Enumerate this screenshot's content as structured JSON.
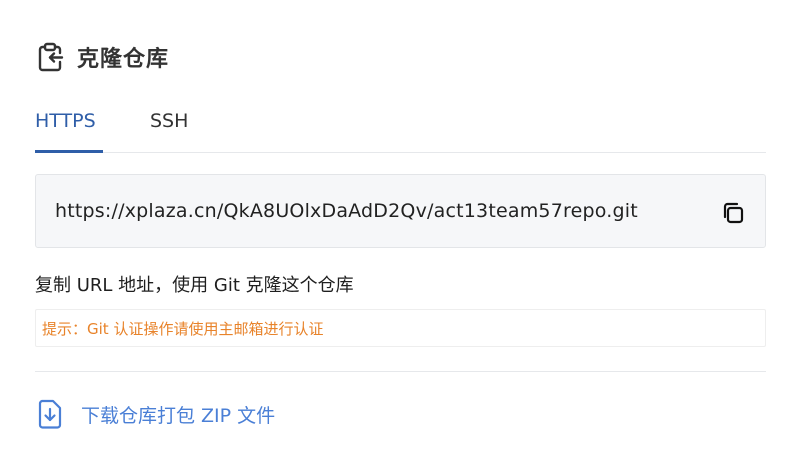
{
  "header": {
    "title": "克隆仓库",
    "icon": "clipboard-arrow-icon"
  },
  "tabs": [
    {
      "label": "HTTPS",
      "active": true
    },
    {
      "label": "SSH",
      "active": false
    }
  ],
  "clone": {
    "url": "https://xplaza.cn/QkA8UOlxDaAdD2Qv/act13team57repo.git",
    "copy_icon": "copy-icon"
  },
  "help_text": "复制 URL 地址，使用 Git 克隆这个仓库",
  "hint_text": "提示：Git 认证操作请使用主邮箱进行认证",
  "download": {
    "label": "下载仓库打包 ZIP 文件",
    "icon": "file-download-icon"
  },
  "colors": {
    "accent": "#2f5ea8",
    "link": "#4a7fd6",
    "warning": "#e8832a"
  }
}
